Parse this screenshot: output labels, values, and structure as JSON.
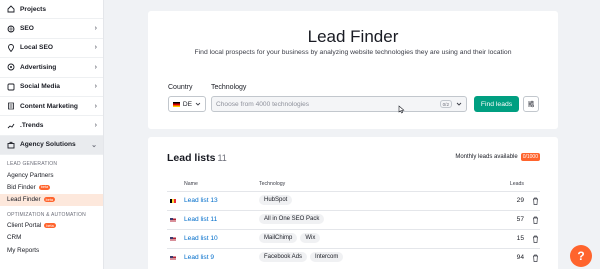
{
  "sidebar": {
    "items": [
      {
        "label": "Projects",
        "icon": "home-icon",
        "chevron": ""
      },
      {
        "label": "SEO",
        "icon": "seo-icon",
        "chevron": "›"
      },
      {
        "label": "Local SEO",
        "icon": "local-pin-icon",
        "chevron": "›"
      },
      {
        "label": "Advertising",
        "icon": "advertising-icon",
        "chevron": "›"
      },
      {
        "label": "Social Media",
        "icon": "social-icon",
        "chevron": "›"
      },
      {
        "label": "Content Marketing",
        "icon": "content-icon",
        "chevron": "›"
      },
      {
        "label": ".Trends",
        "icon": "trends-icon",
        "chevron": "›"
      },
      {
        "label": "Agency Solutions",
        "icon": "agency-icon",
        "chevron": "⌄"
      }
    ],
    "section_lead_generation": "LEAD GENERATION",
    "lead_items": [
      {
        "label": "Agency Partners",
        "badge": ""
      },
      {
        "label": "Bid Finder",
        "badge": "beta"
      },
      {
        "label": "Lead Finder",
        "badge": "beta"
      }
    ],
    "section_optimization": "OPTIMIZATION & AUTOMATION",
    "opt_items": [
      {
        "label": "Client Portal",
        "badge": "beta"
      },
      {
        "label": "CRM",
        "badge": ""
      },
      {
        "label": "My Reports",
        "badge": ""
      }
    ]
  },
  "finder": {
    "title": "Lead Finder",
    "subtitle": "Find local prospects for your business by analyzing website technologies they are using and their location",
    "country_label": "Country",
    "technology_label": "Technology",
    "country_value": "DE",
    "technology_placeholder": "Choose from 4000 technologies",
    "technology_count": "0/2",
    "find_button": "Find leads"
  },
  "lead_lists": {
    "title": "Lead lists",
    "count": "11",
    "monthly_label": "Monthly leads available",
    "monthly_value": "0/1000",
    "columns": {
      "name": "Name",
      "technology": "Technology",
      "leads": "Leads"
    },
    "rows": [
      {
        "flag": "BE",
        "name": "Lead list 13",
        "techs": [
          "HubSpot"
        ],
        "leads": "29"
      },
      {
        "flag": "US",
        "name": "Lead list 11",
        "techs": [
          "All in One SEO Pack"
        ],
        "leads": "57"
      },
      {
        "flag": "US",
        "name": "Lead list 10",
        "techs": [
          "MailChimp",
          "Wix"
        ],
        "leads": "15"
      },
      {
        "flag": "US",
        "name": "Lead list 9",
        "techs": [
          "Facebook Ads",
          "Intercom"
        ],
        "leads": "94"
      }
    ]
  },
  "help_button": "?",
  "colors": {
    "accent": "#ff642d",
    "primary_green": "#009f81",
    "link_blue": "#006dca"
  }
}
